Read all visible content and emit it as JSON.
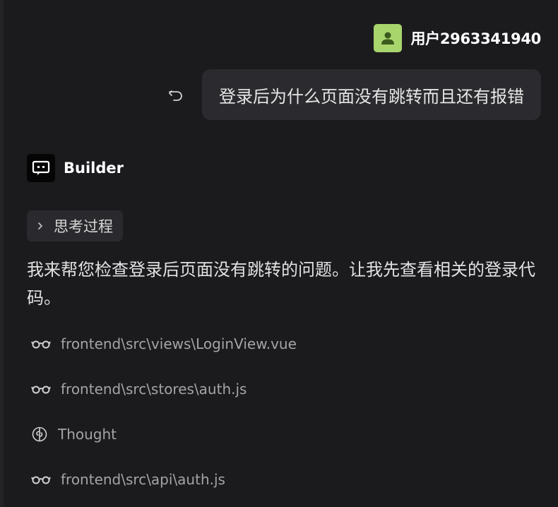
{
  "user": {
    "name": "用户2963341940",
    "avatar_icon": "person-icon",
    "avatar_color": "#a9d56d"
  },
  "user_message": {
    "text": "登录后为什么页面没有跳转而且还有报错",
    "undo_icon": "undo-icon"
  },
  "assistant": {
    "name": "Builder",
    "avatar_icon": "chat-bot-icon",
    "thinking_label": "思考过程",
    "message": "我来帮您检查登录后页面没有跳转的问题。让我先查看相关的登录代码。"
  },
  "activities": [
    {
      "icon": "glasses-icon",
      "label": "frontend\\src\\views\\LoginView.vue"
    },
    {
      "icon": "glasses-icon",
      "label": "frontend\\src\\stores\\auth.js"
    },
    {
      "icon": "brain-icon",
      "label": "Thought"
    },
    {
      "icon": "glasses-icon",
      "label": "frontend\\src\\api\\auth.js"
    }
  ],
  "colors": {
    "background": "#1b1b1e",
    "bubble": "#2b2b2f",
    "chip": "#2a2a2e",
    "muted_text": "#a4a4a8"
  }
}
